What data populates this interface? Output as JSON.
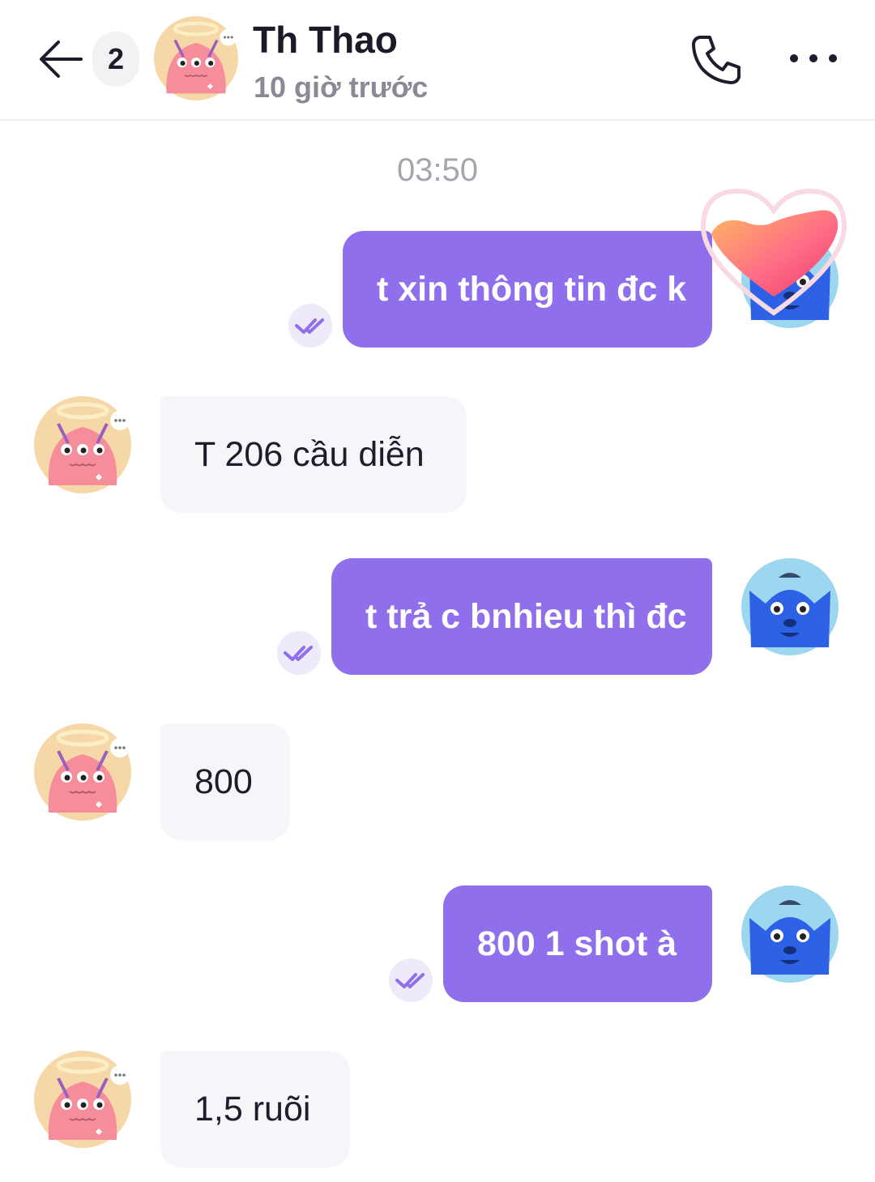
{
  "header": {
    "unread_count": "2",
    "contact_name": "Th Thao",
    "last_seen": "10 giờ trước",
    "icons": {
      "back": "arrow-left-icon",
      "call": "phone-icon",
      "more": "more-horizontal-icon"
    }
  },
  "chat": {
    "timestamp": "03:50",
    "messages": [
      {
        "sender": "me",
        "text": "t xin thông tin đc k",
        "status": "seen-check-icon",
        "reaction": "heart-icon"
      },
      {
        "sender": "contact",
        "text": "T 206 cầu diễn"
      },
      {
        "sender": "me",
        "text": "t trả c bnhieu thì đc",
        "status": "seen-check-icon"
      },
      {
        "sender": "contact",
        "text": "800"
      },
      {
        "sender": "me",
        "text": "800 1 shot à",
        "status": "seen-check-icon"
      },
      {
        "sender": "contact",
        "text": "1,5 ruõi"
      }
    ]
  },
  "colors": {
    "outgoing_bubble": "#8f6fec",
    "incoming_bubble": "#f5f6f9",
    "seen_badge": "#eeeaf9",
    "contact_avatar_bg": "#f6d8a8",
    "contact_avatar_monster": "#f58d9b",
    "my_avatar_bg": "#9dd6ef",
    "my_avatar_monster": "#2d62e6"
  }
}
